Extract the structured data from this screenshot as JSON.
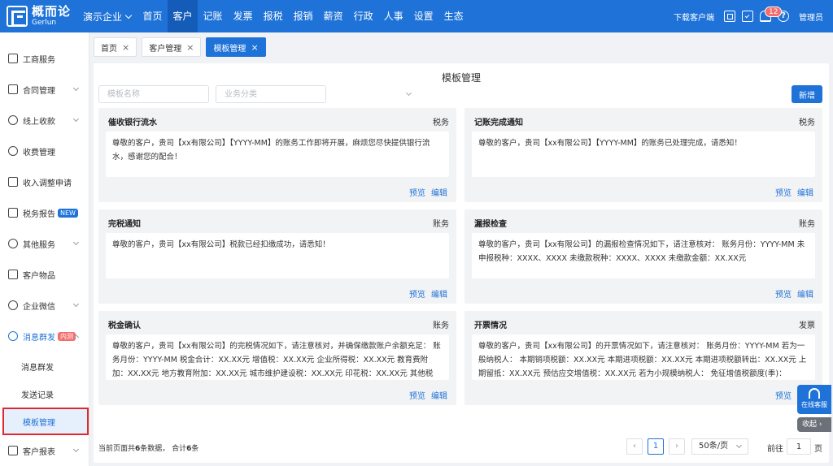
{
  "brand": {
    "name_cn": "概而论",
    "name_en": "Gerlun"
  },
  "header": {
    "corp_selector": "演示企业",
    "nav": [
      "首页",
      "客户",
      "记账",
      "发票",
      "报税",
      "报销",
      "薪资",
      "行政",
      "人事",
      "设置",
      "生态"
    ],
    "active_nav": "客户",
    "download_label": "下载客户端",
    "notification_count": "12",
    "user": "管理员",
    "icons": [
      "scan-icon",
      "clipboard-icon",
      "bell-icon",
      "help-icon"
    ]
  },
  "sidebar": {
    "items": [
      {
        "label": "工商服务",
        "icon": "form-icon"
      },
      {
        "label": "合同管理",
        "icon": "contract-icon"
      },
      {
        "label": "线上收款",
        "icon": "yuan-icon"
      },
      {
        "label": "收费管理",
        "icon": "yuan-circle-icon"
      },
      {
        "label": "收入调整申请",
        "icon": "form-icon"
      },
      {
        "label": "税务报告",
        "icon": "report-icon",
        "tag": "NEW"
      },
      {
        "label": "其他服务",
        "icon": "heart-icon"
      },
      {
        "label": "客户物品",
        "icon": "box-icon"
      },
      {
        "label": "企业微信",
        "icon": "chat-icon"
      },
      {
        "label": "消息群发",
        "icon": "gear-icon",
        "tag": "内测"
      },
      {
        "label": "客户报表",
        "icon": "chart-icon"
      }
    ],
    "sub_items": [
      "消息群发",
      "发送记录",
      "模板管理"
    ],
    "active_sub": "模板管理"
  },
  "tabs": [
    {
      "label": "首页",
      "close": "×"
    },
    {
      "label": "客户管理",
      "close": "×"
    },
    {
      "label": "模板管理",
      "close": "×"
    }
  ],
  "main": {
    "title": "模板管理",
    "name_placeholder": "模板名称",
    "category_placeholder": "业务分类",
    "new_button": "新增",
    "cards": [
      {
        "title": "催收银行流水",
        "category": "税务",
        "body": "尊敬的客户，贵司【xx有限公司】【YYYY-MM】的账务工作即将开展，麻烦您尽快提供银行流水，感谢您的配合！",
        "preview": "预览",
        "edit": "编辑"
      },
      {
        "title": "记账完成通知",
        "category": "税务",
        "body": "尊敬的客户，贵司【xx有限公司】【YYYY-MM】的账务已处理完成，请悉知！",
        "preview": "预览",
        "edit": "编辑"
      },
      {
        "title": "完税通知",
        "category": "账务",
        "body": "尊敬的客户，贵司【xx有限公司】税款已经扣缴成功，请悉知！",
        "preview": "预览",
        "edit": "编辑"
      },
      {
        "title": "漏报检查",
        "category": "账务",
        "body": "尊敬的客户，贵司【xx有限公司】的漏报检查情况如下，请注意核对： 账务月份：YYYY-MM 未申报税种：XXXX、XXXX 未缴款税种：XXXX、XXXX 未缴款金额：XX.XX元",
        "preview": "预览",
        "edit": "编辑"
      },
      {
        "title": "税金确认",
        "category": "账务",
        "body": "尊敬的客户，贵司【xx有限公司】的完税情况如下，请注意核对，并确保缴款账户余额充足： 账务月份：YYYY-MM 税金合计：XX.XX元 增值税：XX.XX元 企业所得税：XX.XX元 教育费附加：XX.XX元 地方教育附加：XX.XX元 城市维护建设税：XX.XX元 印花税：XX.XX元 其他税费：...",
        "preview": "预览",
        "edit": "编辑"
      },
      {
        "title": "开票情况",
        "category": "发票",
        "body": "尊敬的客户，贵司【xx有限公司】的开票情况如下，请注意核对： 账务月份：YYYY-MM 若为一般纳税人： 本期销项税额：XX.XX元 本期进项税额：XX.XX元 本期进项税额转出：XX.XX元 上期留抵：XX.XX元 预估应交增值税：XX.XX元 若为小规模纳税人： 免征增值税额度(季)：XX.X...",
        "preview": "预览",
        "edit": "编辑"
      }
    ]
  },
  "footer": {
    "info_prefix": "当前页面共",
    "info_count": "6",
    "info_mid": "条数据，  合计",
    "info_total": "6",
    "info_suffix": "条"
  },
  "pagination": {
    "prev": "‹",
    "page": "1",
    "next": "›",
    "page_size": "50条/页",
    "goto_label": "前往",
    "goto_value": "1",
    "goto_unit": "页"
  },
  "floating": {
    "service_label": "在线客服",
    "collapse_label": "收起",
    "collapse_arrow": "›"
  }
}
